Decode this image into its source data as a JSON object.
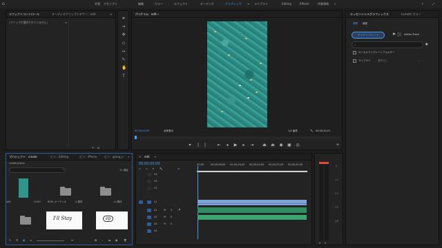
{
  "workspace": {
    "tabs": [
      "学習",
      "アセンブリ",
      "編集",
      "カラー",
      "エフェクト",
      "オーディオ",
      "グラフィック",
      "ライブラリ",
      "Editing",
      "Effects",
      "作業領域"
    ],
    "active_index": 6
  },
  "source_panel": {
    "tabs": [
      "エフェクトコントロール",
      "オーディオクリップミキサー：edit"
    ],
    "message": "(クリップが選択されていません)"
  },
  "program_monitor": {
    "title": "プログラム：edit",
    "timecode_left": "00;00;00;00",
    "fit_label": "全体表示",
    "quality": "1/4 画質",
    "timecode_right": "00;00;40;01"
  },
  "project_panel": {
    "tabs": [
      "プロジェクト：create",
      "ビン：Editing",
      "ビン：iPhone",
      "ビン：going_o"
    ],
    "path": "create.prproj",
    "item_count": "11 項目",
    "items": [
      {
        "label": "edit",
        "kind": "video"
      },
      {
        "label": "LOGO",
        "kind": "folder"
      },
      {
        "label": "BGM_オーディオ",
        "kind": "folder"
      },
      {
        "label": "A 素材",
        "kind": "folder"
      },
      {
        "label": "Lt 素材",
        "kind": "folder"
      },
      {
        "label": "",
        "kind": "folder"
      },
      {
        "label": "",
        "kind": "handwriting1"
      },
      {
        "label": "",
        "kind": "handwriting2"
      }
    ],
    "handwriting1": "I'll Stay",
    "handwriting2": "ep"
  },
  "timeline": {
    "tab": "edit",
    "timecode": "00;00;00;00",
    "ruler": [
      "00;00",
      "00;00;08;00",
      "00;00;16;00",
      "00;00;24;00",
      "00;00;32;00",
      "00;00;40;00",
      "00;00;48;00"
    ],
    "tracks": [
      {
        "id": "V4"
      },
      {
        "id": "V3"
      },
      {
        "id": "V2"
      },
      {
        "id": "V1"
      },
      {
        "id": "A1"
      },
      {
        "id": "A2"
      },
      {
        "id": "A3"
      },
      {
        "id": "A4"
      }
    ]
  },
  "essential_graphics": {
    "tabs": [
      "エッセンシャルグラフィックス",
      "Lumetri カラー"
    ],
    "subtabs": [
      "参照",
      "編集"
    ],
    "library_button": "マイテンプレート",
    "library_name": "Adobe Stock",
    "checkbox1": "ローカルテンプレートフォルダー",
    "checkbox2": "ライブラリ",
    "checkbox2_value": "選択なし"
  },
  "colors": {
    "accent": "#4a9ff5",
    "video_clip": "#7fa3d6",
    "audio_clip": "#2f8f63",
    "meter_red": "#e14a3a"
  }
}
